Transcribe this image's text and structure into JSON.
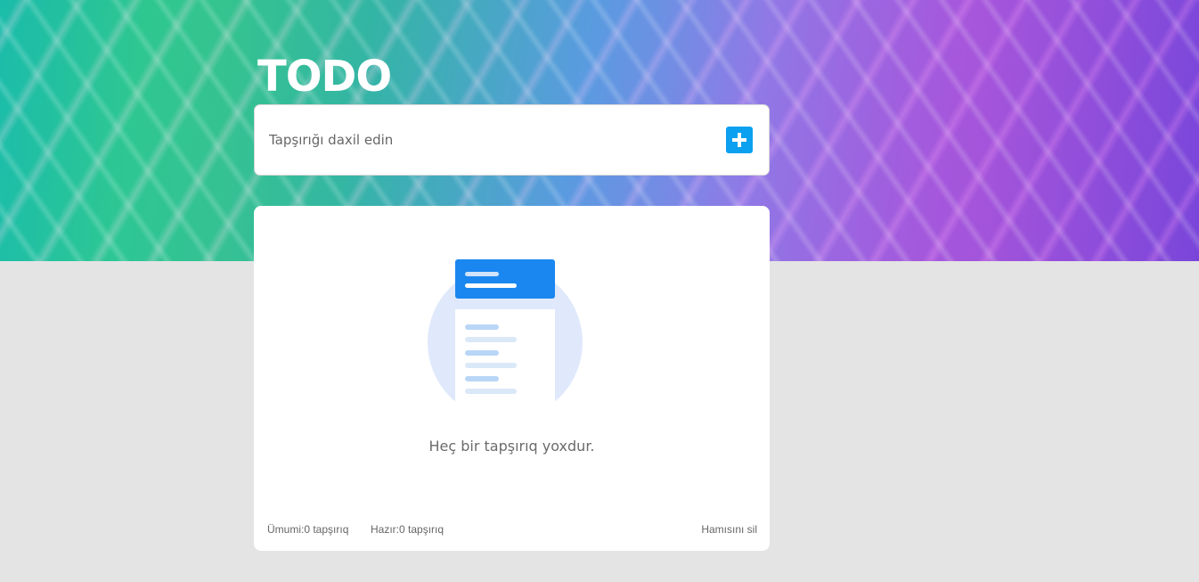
{
  "header": {
    "title": "TODO"
  },
  "task_input": {
    "placeholder": "Tapşırığı daxil edin",
    "value": "",
    "add_button_icon": "plus-icon"
  },
  "task_list": {
    "empty_illustration_icon": "empty-list-illustration",
    "empty_message": "Heç bir tapşırıq yoxdur.",
    "items": []
  },
  "footer": {
    "total_label": "Ümumi:",
    "total_value": "0 tapşırıq",
    "done_label": "Hazır:",
    "done_value": "0 tapşırıq",
    "clear_all_label": "Hamısını sil"
  },
  "colors": {
    "accent": "#0ba0f0",
    "illustration_blue": "#1a87f0",
    "illustration_circle": "#dfe9fb",
    "page_background": "#e4e4e4",
    "card_background": "#ffffff"
  }
}
